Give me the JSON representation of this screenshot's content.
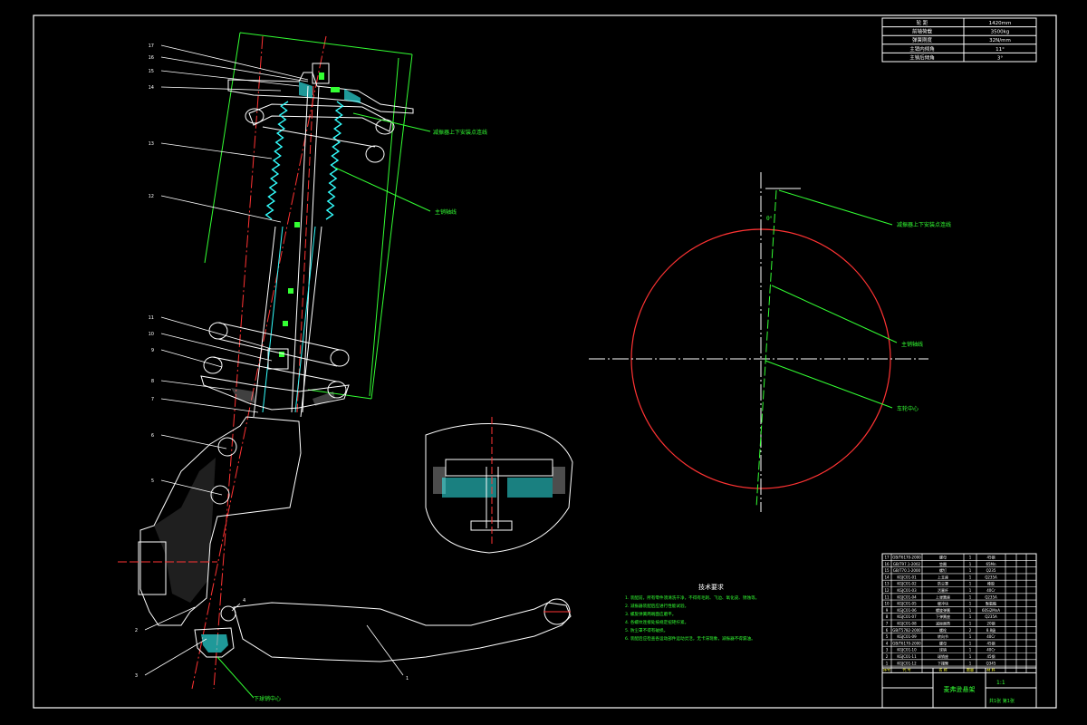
{
  "colors": {
    "background": "#000000",
    "frame": "#ffffff",
    "leader": "#33ff33",
    "centerline": "#ff3333",
    "part_cyan": "#33ffff",
    "hatch": "#ffffff"
  },
  "part_numbers": [
    "17",
    "16",
    "15",
    "14",
    "13",
    "12",
    "11",
    "10",
    "9",
    "8",
    "7",
    "6",
    "5",
    "4",
    "3",
    "2",
    "1"
  ],
  "annotations": {
    "strut_axis": "减振器上下安装点连线",
    "kingpin_axis": "主销轴线",
    "wheel_center": "车轮中心",
    "lower_ball_joint": "下球销中心",
    "upper_angle": "θ°"
  },
  "tech_requirements": {
    "title": "技术要求",
    "lines": [
      "1. 装配前，所有零件须清洗干净，不得有毛刺、飞边、氧化皮、锈蚀等。",
      "2. 减振器装配后应进行性能试验。",
      "3. 螺旋弹簧两端面应磨平。",
      "4. 各螺纹连接处按规定扭矩拧紧。",
      "5. 防尘罩不得有破损。",
      "6. 装配后应检查各运动部件运动灵活，无卡滞现象，减振器不得漏油。"
    ]
  },
  "spec_table": {
    "rows": [
      [
        "轮 距",
        "1420mm"
      ],
      [
        "前轴荷载",
        "3500kg"
      ],
      [
        "弹簧刚度",
        "32N/mm"
      ],
      [
        "主销内倾角",
        "11°"
      ],
      [
        "主销后倾角",
        "3°"
      ]
    ]
  },
  "bom": {
    "rows": [
      [
        "17",
        "GB/T6170-2000",
        "螺母",
        "1",
        "45钢"
      ],
      [
        "16",
        "GB/T97.1-2002",
        "垫圈",
        "1",
        "65Mn"
      ],
      [
        "15",
        "GB/T70.1-2000",
        "螺钉",
        "1",
        "Q235"
      ],
      [
        "14",
        "KGJC01-01",
        "上支座",
        "1",
        "Q235A"
      ],
      [
        "13",
        "KGJC01-02",
        "防尘罩",
        "1",
        "橡胶"
      ],
      [
        "12",
        "KGJC01-03",
        "活塞杆",
        "1",
        "40Cr"
      ],
      [
        "11",
        "KGJC01-04",
        "上弹簧座",
        "1",
        "Q235A"
      ],
      [
        "10",
        "KGJC01-05",
        "缓冲块",
        "1",
        "聚氨酯"
      ],
      [
        "9",
        "KGJC01-06",
        "螺旋弹簧",
        "1",
        "60Si2MnA"
      ],
      [
        "8",
        "KGJC01-07",
        "下弹簧座",
        "1",
        "Q235A"
      ],
      [
        "7",
        "KGJC01-08",
        "减振器筒",
        "1",
        "20钢"
      ],
      [
        "6",
        "GB/T5782-2000",
        "螺栓",
        "2",
        "8.8级"
      ],
      [
        "5",
        "KGJC01-09",
        "转向节",
        "1",
        "40Cr"
      ],
      [
        "4",
        "GB/T6170-2000",
        "螺母",
        "1",
        "45钢"
      ],
      [
        "3",
        "KGJC01-10",
        "球销",
        "1",
        "40Cr"
      ],
      [
        "2",
        "KGJC01-11",
        "球销座",
        "1",
        "45钢"
      ],
      [
        "1",
        "KGJC01-12",
        "下摆臂",
        "1",
        "Q345"
      ]
    ],
    "header": [
      "序号",
      "代 号",
      "名 称",
      "数量",
      "材 料"
    ]
  },
  "title_block": {
    "drawing_name": "麦弗逊悬架",
    "scale": "1:1",
    "sheet": "共1张 第1张"
  }
}
